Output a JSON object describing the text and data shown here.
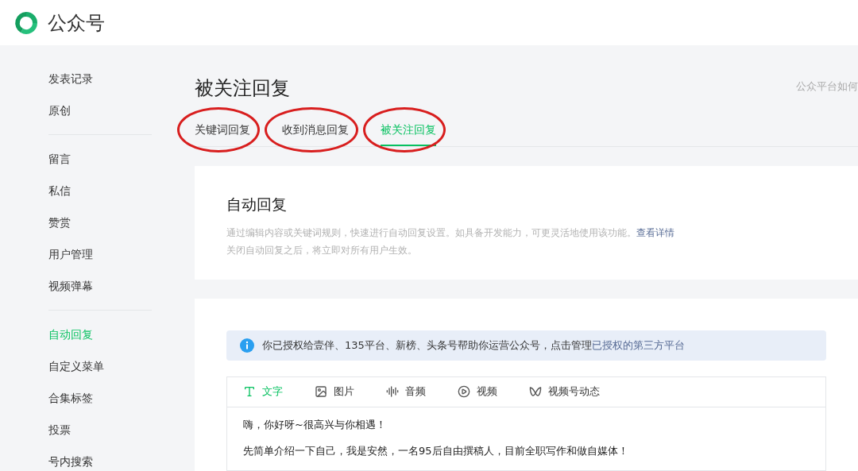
{
  "header": {
    "brand": "公众号"
  },
  "sidebar": {
    "groups": [
      [
        {
          "label": "发表记录",
          "selected": false
        },
        {
          "label": "原创",
          "selected": false
        }
      ],
      [
        {
          "label": "留言",
          "selected": false
        },
        {
          "label": "私信",
          "selected": false
        },
        {
          "label": "赞赏",
          "selected": false
        },
        {
          "label": "用户管理",
          "selected": false
        },
        {
          "label": "视频弹幕",
          "selected": false
        }
      ],
      [
        {
          "label": "自动回复",
          "selected": true
        },
        {
          "label": "自定义菜单",
          "selected": false
        },
        {
          "label": "合集标签",
          "selected": false
        },
        {
          "label": "投票",
          "selected": false
        },
        {
          "label": "号内搜索",
          "selected": false
        }
      ]
    ]
  },
  "page": {
    "title": "被关注回复",
    "help_link": "公众平台如何",
    "tabs": [
      {
        "label": "关键词回复",
        "selected": false,
        "circled": true
      },
      {
        "label": "收到消息回复",
        "selected": false,
        "circled": true
      },
      {
        "label": "被关注回复",
        "selected": true,
        "circled": true
      }
    ]
  },
  "intro_card": {
    "title": "自动回复",
    "description": "通过编辑内容或关键词规则，快速进行自动回复设置。如具备开发能力，可更灵活地使用该功能。",
    "details_link": "查看详情",
    "note": "关闭自动回复之后，将立即对所有用户生效。"
  },
  "notice": {
    "text": "你已授权给壹伴、135平台、新榜、头条号帮助你运营公众号，点击管理",
    "link": "已授权的第三方平台"
  },
  "editor": {
    "types": [
      {
        "kind": "text",
        "label": "文字",
        "selected": true
      },
      {
        "kind": "image",
        "label": "图片",
        "selected": false
      },
      {
        "kind": "audio",
        "label": "音频",
        "selected": false
      },
      {
        "kind": "video",
        "label": "视频",
        "selected": false
      },
      {
        "kind": "channels",
        "label": "视频号动态",
        "selected": false
      }
    ],
    "paragraphs": [
      "嗨，你好呀~很高兴与你相遇！",
      "先简单介绍一下自己，我是安然，一名95后自由撰稿人，目前全职写作和做自媒体！"
    ]
  }
}
